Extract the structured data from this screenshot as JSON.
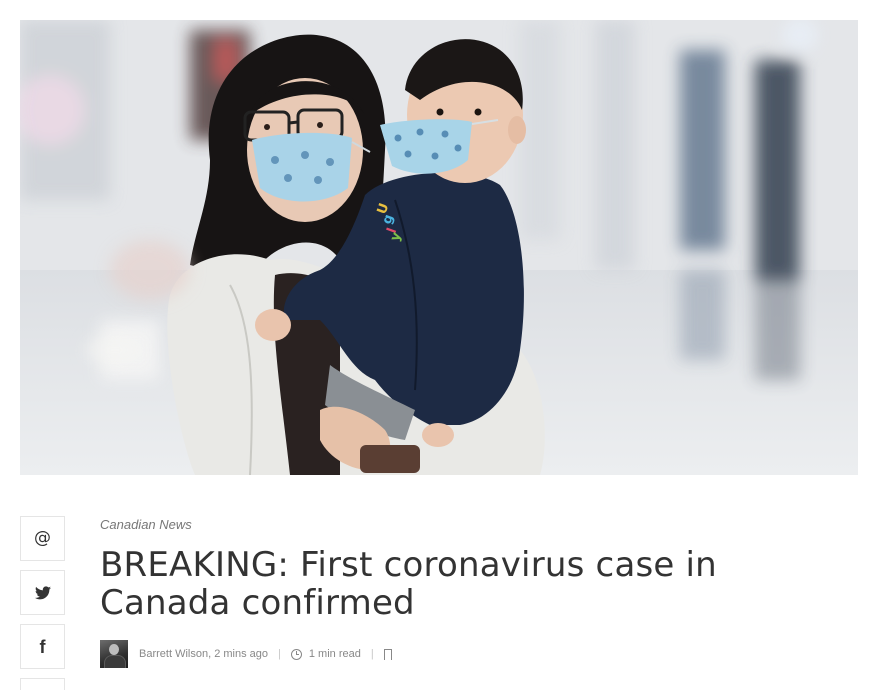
{
  "hero": {
    "image_label": "Woman and child wearing face masks"
  },
  "share": {
    "items": [
      {
        "icon": "at-sign-icon",
        "glyph": "@"
      },
      {
        "icon": "twitter-icon",
        "glyph": "🐦"
      },
      {
        "icon": "facebook-icon",
        "glyph": "f"
      }
    ]
  },
  "article": {
    "category": "Canadian News",
    "headline": "BREAKING: First coronavirus case in Canada confirmed",
    "author": "Barrett Wilson",
    "time_ago": ", 2 mins ago",
    "read_time": "1 min read",
    "separator": "|"
  }
}
